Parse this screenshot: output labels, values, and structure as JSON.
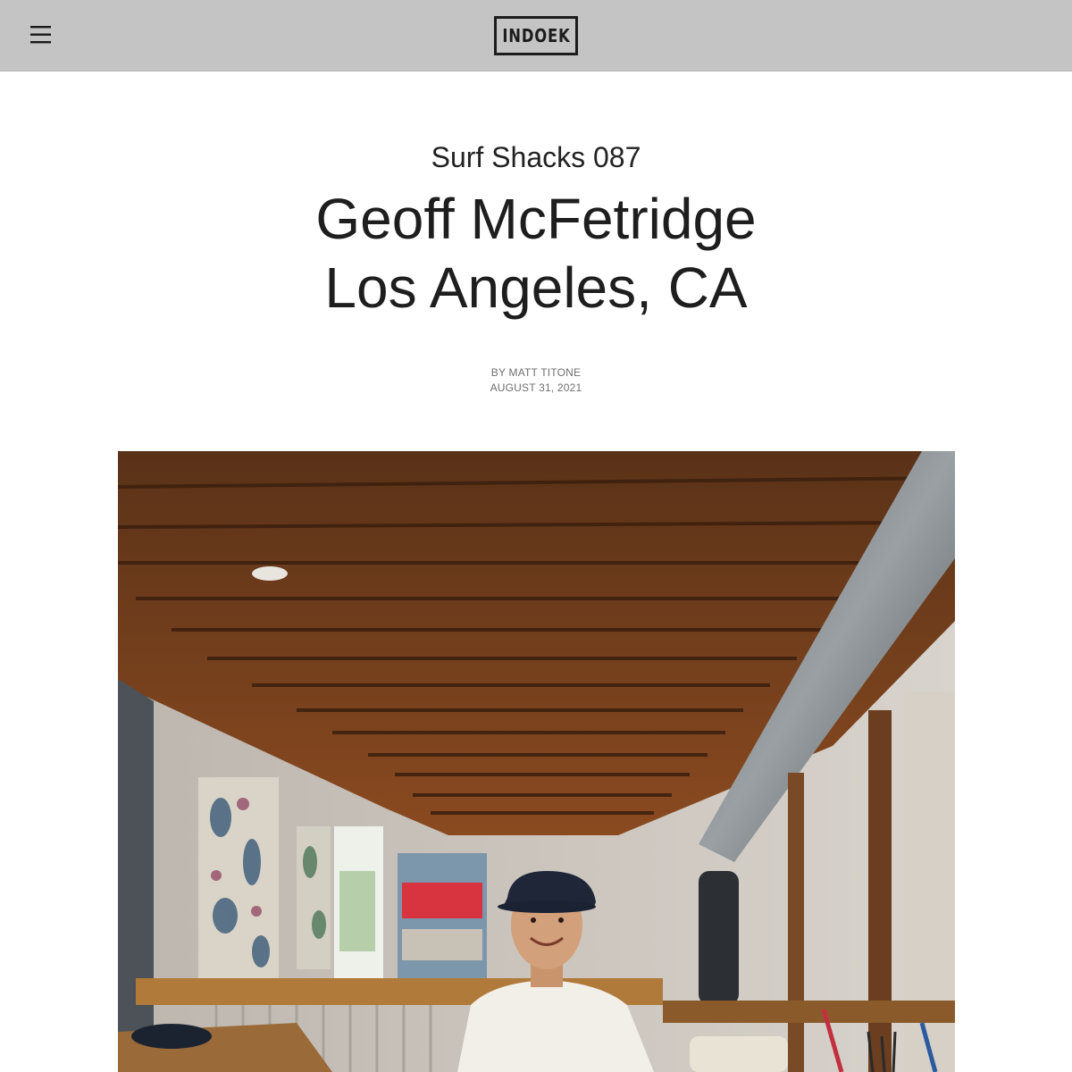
{
  "header": {
    "menu_icon": "hamburger-menu-icon",
    "logo_text": "INDOEK",
    "background_color": "#c4c4c4"
  },
  "article": {
    "series": "Surf Shacks 087",
    "title_line1": "Geoff McFetridge",
    "title_line2": "Los Angeles, CA",
    "author": "BY MATT TITONE",
    "date": "AUGUST 31, 2021"
  },
  "hero_image": {
    "subject": "man in navy cap and white t-shirt seated in studio with wooden beamed ceiling"
  }
}
